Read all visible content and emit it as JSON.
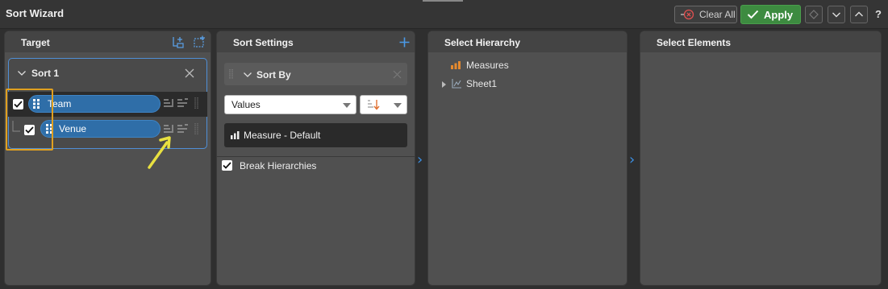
{
  "window": {
    "title": "Sort Wizard"
  },
  "toolbar": {
    "clear_all_label": "Clear All",
    "apply_label": "Apply",
    "help_label": "?"
  },
  "target": {
    "title": "Target",
    "sort_card": {
      "label": "Sort 1",
      "items": [
        {
          "label": "Team",
          "checked": true
        },
        {
          "label": "Venue",
          "checked": true
        }
      ]
    }
  },
  "sort_settings": {
    "title": "Sort Settings",
    "sort_by_label": "Sort By",
    "values_dropdown": "Values",
    "measure_label": "Measure - Default",
    "break_hierarchies_label": "Break Hierarchies",
    "break_hierarchies_checked": true
  },
  "select_hierarchy": {
    "title": "Select Hierarchy",
    "items": [
      {
        "label": "Measures",
        "icon": "bar-chart-icon"
      },
      {
        "label": "Sheet1",
        "icon": "hierarchy-icon"
      }
    ]
  },
  "select_elements": {
    "title": "Select Elements"
  },
  "colors": {
    "accent_blue": "#3b8fe3",
    "apply_green": "#3d8b40",
    "highlight_orange": "#e0a020",
    "pill_blue": "#2f6ea8",
    "measures_orange": "#e68a2e"
  }
}
